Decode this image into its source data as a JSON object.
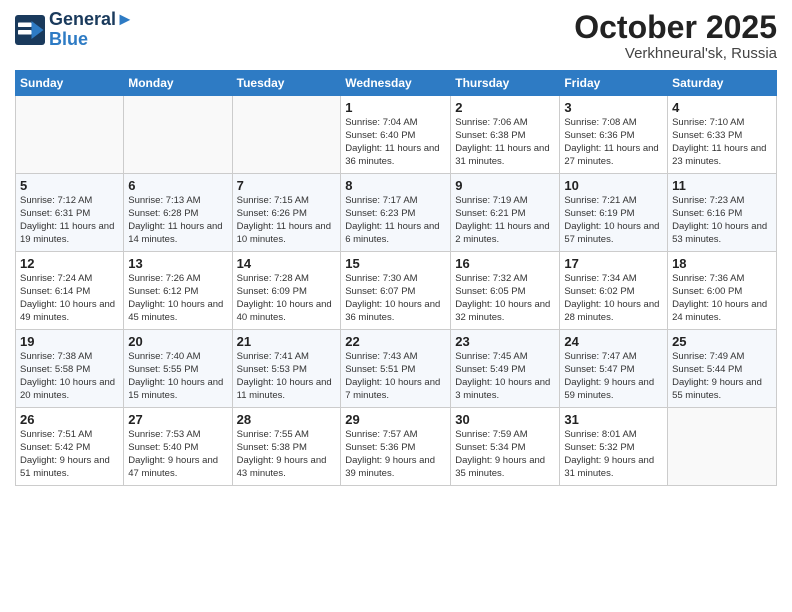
{
  "header": {
    "logo_line1": "General",
    "logo_line2": "Blue",
    "month_title": "October 2025",
    "subtitle": "Verkhneural'sk, Russia"
  },
  "weekdays": [
    "Sunday",
    "Monday",
    "Tuesday",
    "Wednesday",
    "Thursday",
    "Friday",
    "Saturday"
  ],
  "weeks": [
    [
      {
        "day": "",
        "info": ""
      },
      {
        "day": "",
        "info": ""
      },
      {
        "day": "",
        "info": ""
      },
      {
        "day": "1",
        "info": "Sunrise: 7:04 AM\nSunset: 6:40 PM\nDaylight: 11 hours\nand 36 minutes."
      },
      {
        "day": "2",
        "info": "Sunrise: 7:06 AM\nSunset: 6:38 PM\nDaylight: 11 hours\nand 31 minutes."
      },
      {
        "day": "3",
        "info": "Sunrise: 7:08 AM\nSunset: 6:36 PM\nDaylight: 11 hours\nand 27 minutes."
      },
      {
        "day": "4",
        "info": "Sunrise: 7:10 AM\nSunset: 6:33 PM\nDaylight: 11 hours\nand 23 minutes."
      }
    ],
    [
      {
        "day": "5",
        "info": "Sunrise: 7:12 AM\nSunset: 6:31 PM\nDaylight: 11 hours\nand 19 minutes."
      },
      {
        "day": "6",
        "info": "Sunrise: 7:13 AM\nSunset: 6:28 PM\nDaylight: 11 hours\nand 14 minutes."
      },
      {
        "day": "7",
        "info": "Sunrise: 7:15 AM\nSunset: 6:26 PM\nDaylight: 11 hours\nand 10 minutes."
      },
      {
        "day": "8",
        "info": "Sunrise: 7:17 AM\nSunset: 6:23 PM\nDaylight: 11 hours\nand 6 minutes."
      },
      {
        "day": "9",
        "info": "Sunrise: 7:19 AM\nSunset: 6:21 PM\nDaylight: 11 hours\nand 2 minutes."
      },
      {
        "day": "10",
        "info": "Sunrise: 7:21 AM\nSunset: 6:19 PM\nDaylight: 10 hours\nand 57 minutes."
      },
      {
        "day": "11",
        "info": "Sunrise: 7:23 AM\nSunset: 6:16 PM\nDaylight: 10 hours\nand 53 minutes."
      }
    ],
    [
      {
        "day": "12",
        "info": "Sunrise: 7:24 AM\nSunset: 6:14 PM\nDaylight: 10 hours\nand 49 minutes."
      },
      {
        "day": "13",
        "info": "Sunrise: 7:26 AM\nSunset: 6:12 PM\nDaylight: 10 hours\nand 45 minutes."
      },
      {
        "day": "14",
        "info": "Sunrise: 7:28 AM\nSunset: 6:09 PM\nDaylight: 10 hours\nand 40 minutes."
      },
      {
        "day": "15",
        "info": "Sunrise: 7:30 AM\nSunset: 6:07 PM\nDaylight: 10 hours\nand 36 minutes."
      },
      {
        "day": "16",
        "info": "Sunrise: 7:32 AM\nSunset: 6:05 PM\nDaylight: 10 hours\nand 32 minutes."
      },
      {
        "day": "17",
        "info": "Sunrise: 7:34 AM\nSunset: 6:02 PM\nDaylight: 10 hours\nand 28 minutes."
      },
      {
        "day": "18",
        "info": "Sunrise: 7:36 AM\nSunset: 6:00 PM\nDaylight: 10 hours\nand 24 minutes."
      }
    ],
    [
      {
        "day": "19",
        "info": "Sunrise: 7:38 AM\nSunset: 5:58 PM\nDaylight: 10 hours\nand 20 minutes."
      },
      {
        "day": "20",
        "info": "Sunrise: 7:40 AM\nSunset: 5:55 PM\nDaylight: 10 hours\nand 15 minutes."
      },
      {
        "day": "21",
        "info": "Sunrise: 7:41 AM\nSunset: 5:53 PM\nDaylight: 10 hours\nand 11 minutes."
      },
      {
        "day": "22",
        "info": "Sunrise: 7:43 AM\nSunset: 5:51 PM\nDaylight: 10 hours\nand 7 minutes."
      },
      {
        "day": "23",
        "info": "Sunrise: 7:45 AM\nSunset: 5:49 PM\nDaylight: 10 hours\nand 3 minutes."
      },
      {
        "day": "24",
        "info": "Sunrise: 7:47 AM\nSunset: 5:47 PM\nDaylight: 9 hours\nand 59 minutes."
      },
      {
        "day": "25",
        "info": "Sunrise: 7:49 AM\nSunset: 5:44 PM\nDaylight: 9 hours\nand 55 minutes."
      }
    ],
    [
      {
        "day": "26",
        "info": "Sunrise: 7:51 AM\nSunset: 5:42 PM\nDaylight: 9 hours\nand 51 minutes."
      },
      {
        "day": "27",
        "info": "Sunrise: 7:53 AM\nSunset: 5:40 PM\nDaylight: 9 hours\nand 47 minutes."
      },
      {
        "day": "28",
        "info": "Sunrise: 7:55 AM\nSunset: 5:38 PM\nDaylight: 9 hours\nand 43 minutes."
      },
      {
        "day": "29",
        "info": "Sunrise: 7:57 AM\nSunset: 5:36 PM\nDaylight: 9 hours\nand 39 minutes."
      },
      {
        "day": "30",
        "info": "Sunrise: 7:59 AM\nSunset: 5:34 PM\nDaylight: 9 hours\nand 35 minutes."
      },
      {
        "day": "31",
        "info": "Sunrise: 8:01 AM\nSunset: 5:32 PM\nDaylight: 9 hours\nand 31 minutes."
      },
      {
        "day": "",
        "info": ""
      }
    ]
  ]
}
